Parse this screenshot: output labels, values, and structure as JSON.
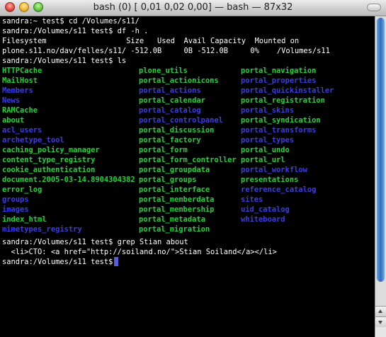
{
  "window": {
    "title": "bash (0)  [ 0,01 0,02 0,00] — bash — 87x32"
  },
  "terminal": {
    "lines_top": [
      "sandra:~ test$ cd /Volumes/s11/",
      "sandra:/Volumes/s11 test$ df -h .",
      "Filesystem                  Size   Used  Avail Capacity  Mounted on",
      "plone.s11.no/dav/felles/s11/ -512.0B     0B -512.0B     0%    /Volumes/s11",
      "sandra:/Volumes/s11 test$ ls"
    ],
    "ls_columns": [
      [
        {
          "t": "HTTPCache",
          "c": "green"
        },
        {
          "t": "MailHost",
          "c": "green"
        },
        {
          "t": "Members",
          "c": "blue"
        },
        {
          "t": "News",
          "c": "blue"
        },
        {
          "t": "RAMCache",
          "c": "green"
        },
        {
          "t": "about",
          "c": "green"
        },
        {
          "t": "acl_users",
          "c": "blue"
        },
        {
          "t": "archetype_tool",
          "c": "blue"
        },
        {
          "t": "caching_policy_manager",
          "c": "green"
        },
        {
          "t": "content_type_registry",
          "c": "green"
        },
        {
          "t": "cookie_authentication",
          "c": "green"
        },
        {
          "t": "document.2005-03-14.8904304382",
          "c": "green"
        },
        {
          "t": "error_log",
          "c": "green"
        },
        {
          "t": "groups",
          "c": "blue"
        },
        {
          "t": "images",
          "c": "blue"
        },
        {
          "t": "index_html",
          "c": "green"
        },
        {
          "t": "mimetypes_registry",
          "c": "blue"
        }
      ],
      [
        {
          "t": "plone_utils",
          "c": "green"
        },
        {
          "t": "portal_actionicons",
          "c": "green"
        },
        {
          "t": "portal_actions",
          "c": "blue"
        },
        {
          "t": "portal_calendar",
          "c": "green"
        },
        {
          "t": "portal_catalog",
          "c": "blue"
        },
        {
          "t": "portal_controlpanel",
          "c": "blue"
        },
        {
          "t": "portal_discussion",
          "c": "green"
        },
        {
          "t": "portal_factory",
          "c": "green"
        },
        {
          "t": "portal_form",
          "c": "green"
        },
        {
          "t": "portal_form_controller",
          "c": "green"
        },
        {
          "t": "portal_groupdata",
          "c": "green"
        },
        {
          "t": "portal_groups",
          "c": "green"
        },
        {
          "t": "portal_interface",
          "c": "green"
        },
        {
          "t": "portal_memberdata",
          "c": "green"
        },
        {
          "t": "portal_membership",
          "c": "green"
        },
        {
          "t": "portal_metadata",
          "c": "green"
        },
        {
          "t": "portal_migration",
          "c": "green"
        }
      ],
      [
        {
          "t": "portal_navigation",
          "c": "green"
        },
        {
          "t": "portal_properties",
          "c": "blue"
        },
        {
          "t": "portal_quickinstaller",
          "c": "blue"
        },
        {
          "t": "portal_registration",
          "c": "green"
        },
        {
          "t": "portal_skins",
          "c": "blue"
        },
        {
          "t": "portal_syndication",
          "c": "green"
        },
        {
          "t": "portal_transforms",
          "c": "blue"
        },
        {
          "t": "portal_types",
          "c": "blue"
        },
        {
          "t": "portal_undo",
          "c": "green"
        },
        {
          "t": "portal_url",
          "c": "green"
        },
        {
          "t": "portal_workflow",
          "c": "blue"
        },
        {
          "t": "presentations",
          "c": "green"
        },
        {
          "t": "reference_catalog",
          "c": "blue"
        },
        {
          "t": "sites",
          "c": "blue"
        },
        {
          "t": "uid_catalog",
          "c": "blue"
        },
        {
          "t": "whiteboard",
          "c": "blue"
        }
      ]
    ],
    "lines_bottom": [
      "sandra:/Volumes/s11 test$ grep Stian about",
      "  <li>CTO: <a href=\"http://soiland.no/\">Stian Soiland</a></li>",
      "sandra:/Volumes/s11 test$ "
    ],
    "colors": {
      "green": "#22d33a",
      "blue": "#3d3de6",
      "text": "#ffffff",
      "background": "#000000",
      "cursor": "#5a5adc"
    }
  }
}
